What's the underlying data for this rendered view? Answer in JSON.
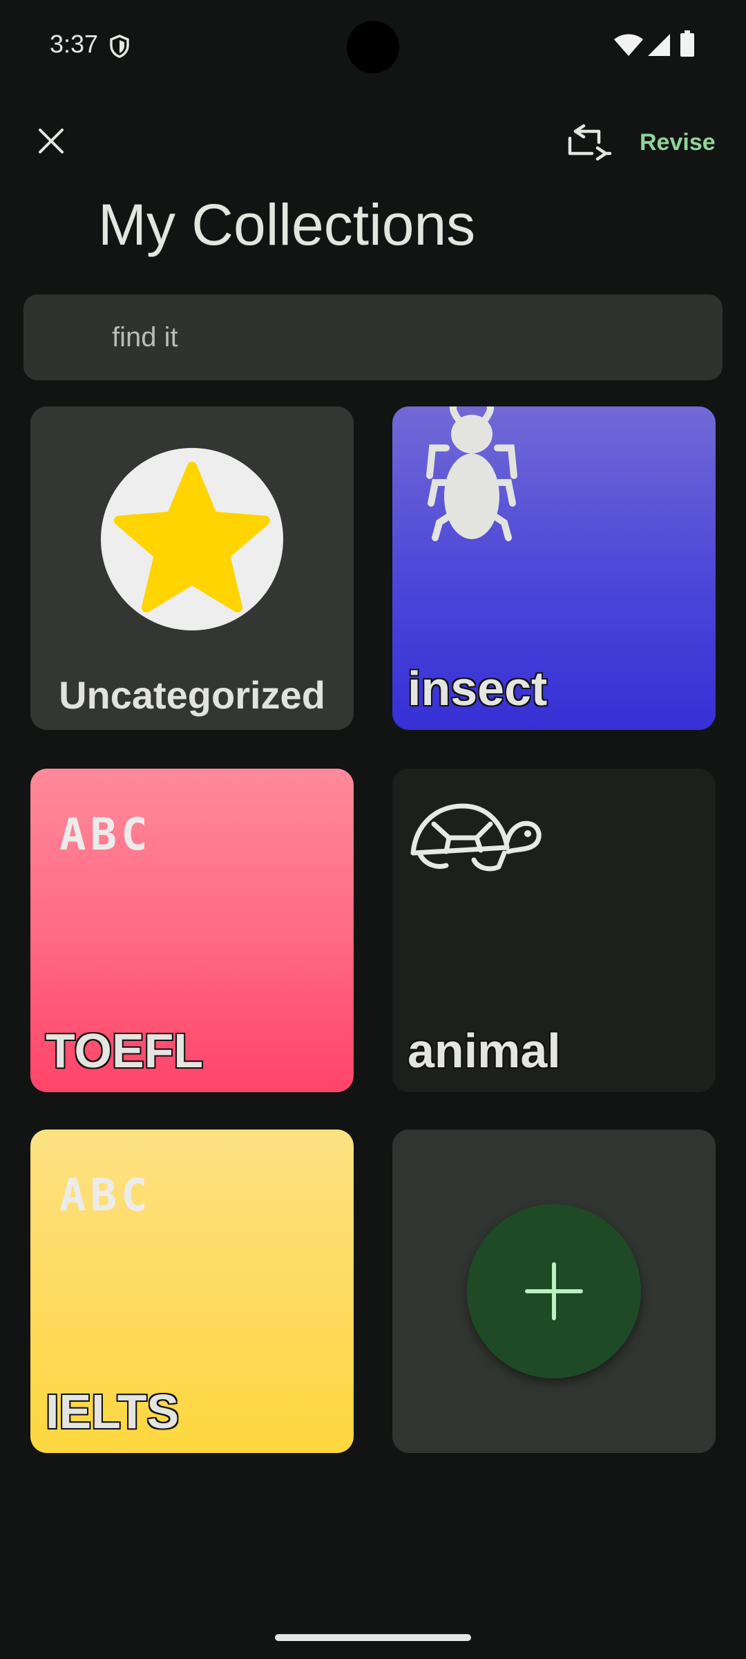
{
  "status_bar": {
    "time": "3:37",
    "icons": [
      "shield-icon",
      "wifi-icon",
      "cellular-signal-icon",
      "battery-icon"
    ]
  },
  "app_bar": {
    "close_icon": "close-icon",
    "swap_icon": "swap-icon",
    "revise_label": "Revise"
  },
  "page": {
    "title": "My Collections"
  },
  "search": {
    "placeholder": "find it",
    "value": ""
  },
  "collections": [
    {
      "label": "Uncategorized",
      "icon": "star-icon",
      "color": "#333632"
    },
    {
      "label": "insect",
      "icon": "ant-icon",
      "color": "#4b46d8"
    },
    {
      "label": "TOEFL",
      "icon": "abc-icon",
      "icon_text": "ABC",
      "color": "#ff6b84"
    },
    {
      "label": "animal",
      "icon": "turtle-icon",
      "color": "#1c1f1c"
    },
    {
      "label": "IELTS",
      "icon": "abc-icon",
      "icon_text": "ABC",
      "color": "#fed95a"
    }
  ],
  "add_card": {
    "icon": "plus-icon",
    "color": "#1f4a26"
  },
  "colors": {
    "background": "#111412",
    "accent": "#8fd49a",
    "star": "#ffd400"
  }
}
